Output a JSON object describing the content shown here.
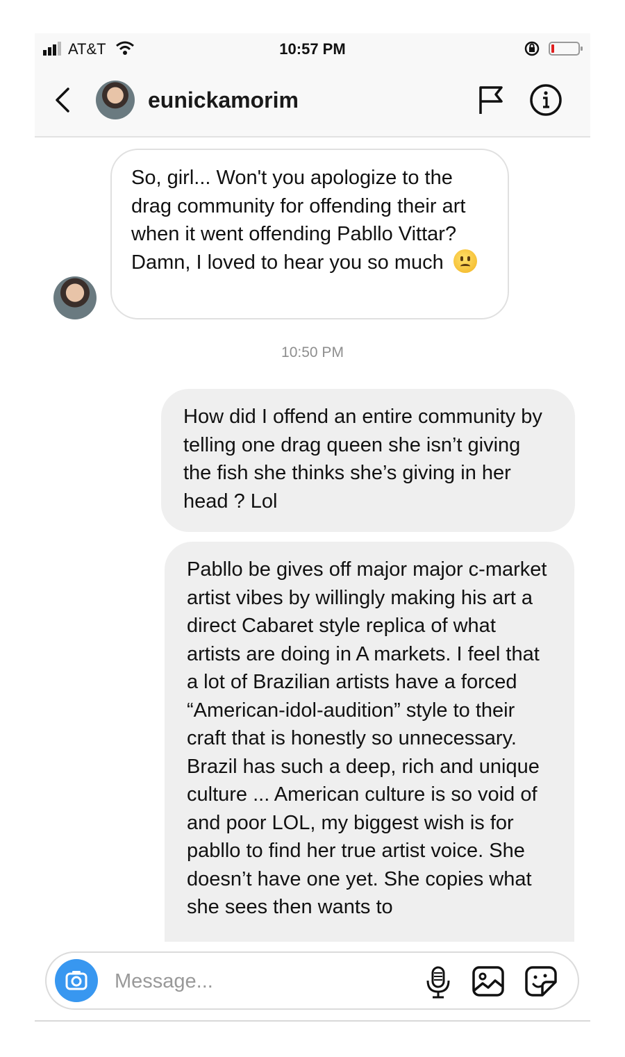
{
  "status_bar": {
    "carrier": "AT&T",
    "time": "10:57 PM"
  },
  "header": {
    "username": "eunickamorim"
  },
  "messages": [
    {
      "sender": "them",
      "text": "So, girl... Won't you apologize to the drag community for offending their art when it went offending Pabllo Vittar? Damn, I loved to hear you so much",
      "emoji": "frowning-face"
    },
    {
      "type": "timestamp",
      "text": "10:50 PM"
    },
    {
      "sender": "me",
      "text": "How did I offend an entire community by telling one drag queen she isn’t giving the fish she thinks she’s giving in her head ? Lol"
    },
    {
      "sender": "me",
      "text": "Pabllo be gives off major major c-market artist vibes by willingly making his art a direct Cabaret style replica of what artists are doing in A markets. I feel that a lot of Brazilian artists have a forced “American-idol-audition” style to their craft that is honestly so unnecessary. Brazil has such a deep, rich and unique culture ... American culture is so void of and poor LOL, my biggest wish is for pabllo to find her true artist voice. She doesn’t have one yet. She copies what she sees then wants to"
    }
  ],
  "composer": {
    "placeholder": "Message..."
  },
  "colors": {
    "accent": "#3897f0",
    "received_bubble": "#ffffff",
    "sent_bubble": "#efefef",
    "timestamp": "#8e8e8e"
  },
  "icons": [
    "signal-icon",
    "wifi-icon",
    "rotation-lock-icon",
    "battery-icon",
    "back-chevron-icon",
    "flag-icon",
    "info-icon",
    "camera-icon",
    "microphone-icon",
    "gallery-icon",
    "sticker-icon"
  ]
}
